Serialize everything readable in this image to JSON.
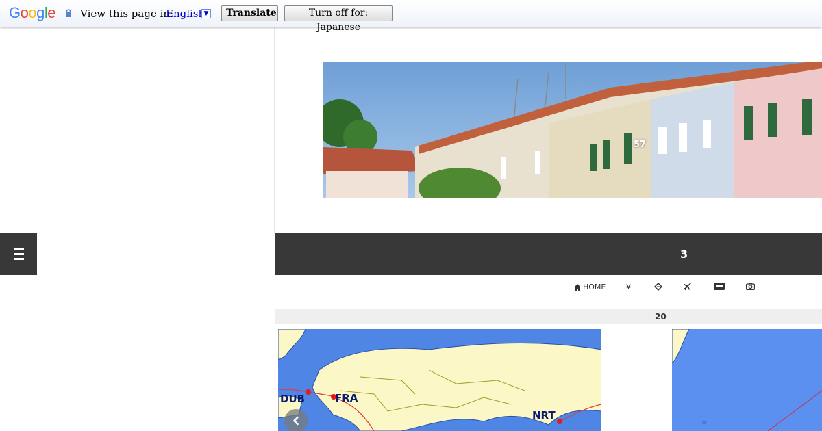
{
  "translate_bar": {
    "logo_letters": [
      {
        "char": "G",
        "color": "#4285f4"
      },
      {
        "char": "o",
        "color": "#ea4335"
      },
      {
        "char": "o",
        "color": "#fbbc05"
      },
      {
        "char": "g",
        "color": "#4285f4"
      },
      {
        "char": "l",
        "color": "#34a853"
      },
      {
        "char": "e",
        "color": "#ea4335"
      }
    ],
    "view_text": "View this page in:",
    "language": "English",
    "dropdown_glyph": "▼",
    "translate_label": "Translate",
    "turn_off_label": "Turn off for: Japanese"
  },
  "banner": {
    "count": "57"
  },
  "header": {
    "number": "3"
  },
  "nav": {
    "home_label": "HOME",
    "yen_glyph": "¥",
    "icons": [
      "home-icon",
      "yen-icon",
      "ticket-icon",
      "plane-icon",
      "visa-icon",
      "camera-icon"
    ]
  },
  "section": {
    "count": "20"
  },
  "map": {
    "labels": [
      "DUB",
      "FRA",
      "NRT"
    ]
  },
  "colors": {
    "dark_bar": "#383838",
    "sea": "#4f86e6",
    "land": "#fbf7c6",
    "route": "#e23b3b"
  }
}
